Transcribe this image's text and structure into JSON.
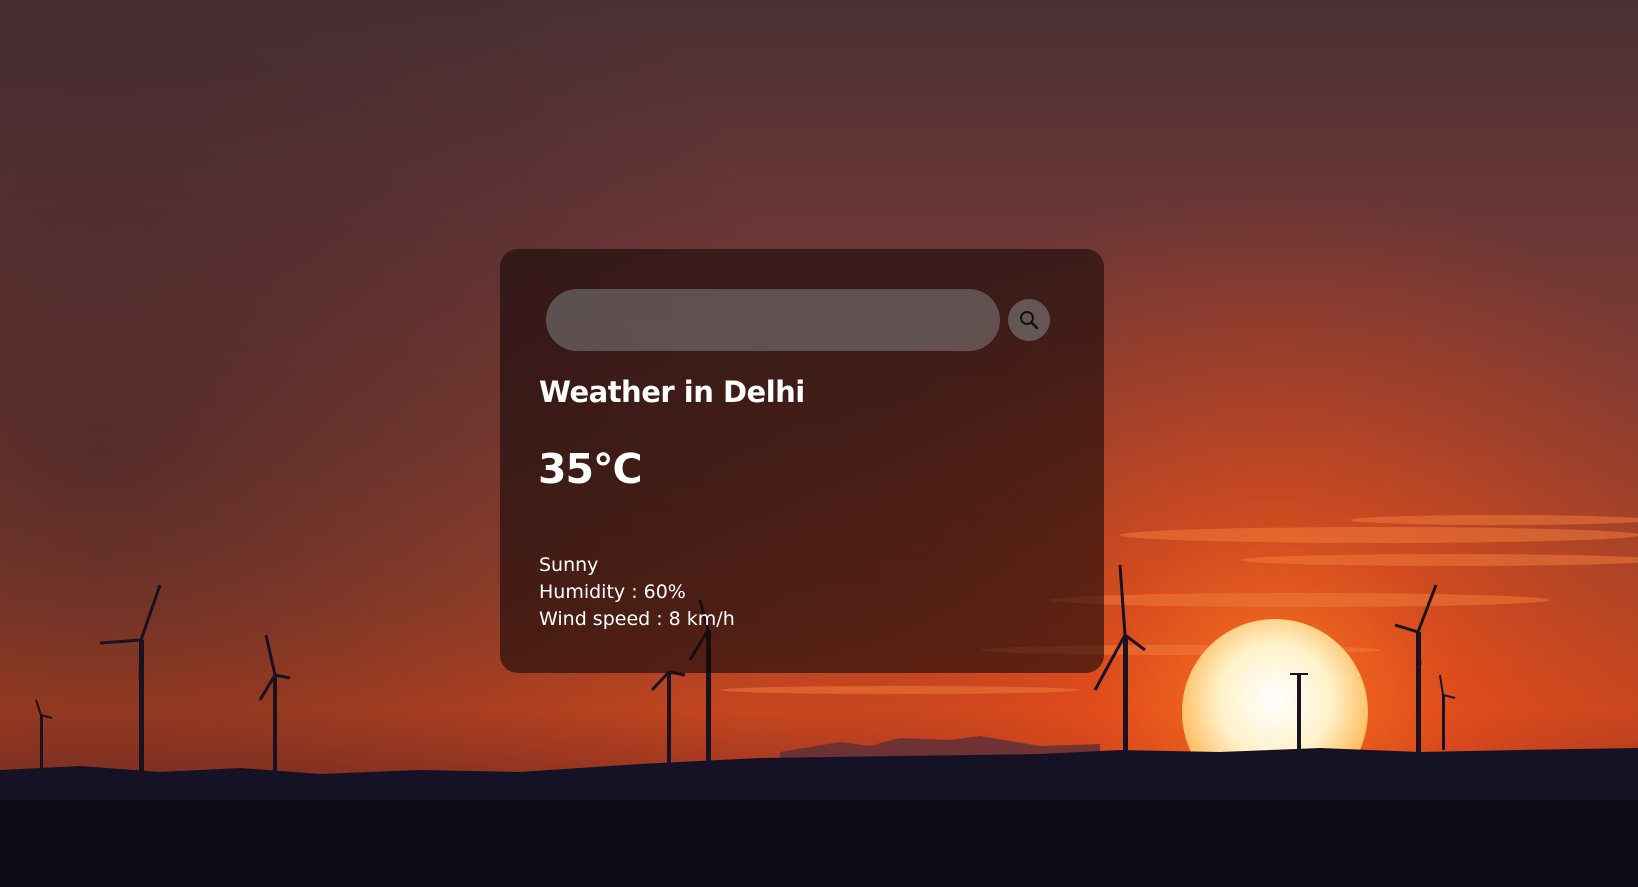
{
  "search": {
    "placeholder": "",
    "value": "",
    "button_icon": "search-icon"
  },
  "weather": {
    "city_heading": "Weather in Delhi",
    "temperature": "35°C",
    "description": "Sunny",
    "humidity": "Humidity : 60%",
    "wind": "Wind speed : 8 km/h"
  },
  "colors": {
    "card_background": "#180a0a",
    "sky_top": "#4a2e32",
    "sky_horizon": "#e8501e",
    "sun": "#fff4d6",
    "ground": "#0d0d1a"
  }
}
